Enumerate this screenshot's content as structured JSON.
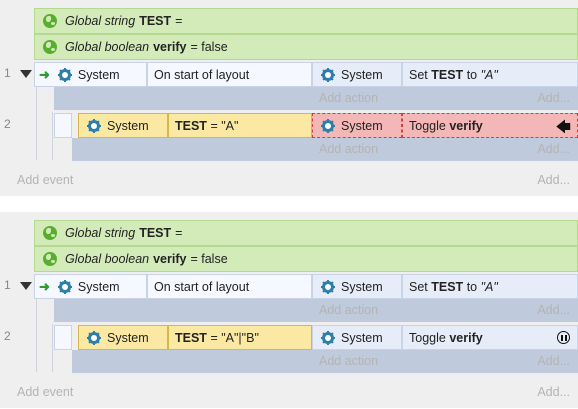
{
  "panels": [
    {
      "global_string": {
        "type": "Global string",
        "name": "TEST",
        "suffix": "="
      },
      "global_boolean": {
        "type": "Global boolean",
        "name": "verify",
        "suffix": "= false"
      },
      "event1": {
        "number": "1",
        "condition_object": "System",
        "condition_text": "On start of layout",
        "action_object": "System",
        "action_prefix": "Set",
        "action_var": "TEST",
        "action_mid": "to",
        "action_value": "\"A\"",
        "add_action": "Add action",
        "add_more": "Add..."
      },
      "event2": {
        "number": "2",
        "condition_object": "System",
        "condition_var": "TEST",
        "condition_value": "= \"A\"",
        "action_object": "System",
        "action_prefix": "Toggle",
        "action_var": "verify",
        "status_icon": "breakpoint-arrow-icon",
        "add_action": "Add action",
        "add_more": "Add..."
      },
      "add_event": "Add event",
      "add_more": "Add..."
    },
    {
      "global_string": {
        "type": "Global string",
        "name": "TEST",
        "suffix": "="
      },
      "global_boolean": {
        "type": "Global boolean",
        "name": "verify",
        "suffix": "= false"
      },
      "event1": {
        "number": "1",
        "condition_object": "System",
        "condition_text": "On start of layout",
        "action_object": "System",
        "action_prefix": "Set",
        "action_var": "TEST",
        "action_mid": "to",
        "action_value": "\"A\"",
        "add_action": "Add action",
        "add_more": "Add..."
      },
      "event2": {
        "number": "2",
        "condition_object": "System",
        "condition_var": "TEST",
        "condition_value": "= \"A\"|\"B\"",
        "action_object": "System",
        "action_prefix": "Toggle",
        "action_var": "verify",
        "status_icon": "pause-icon",
        "add_action": "Add action",
        "add_more": "Add..."
      },
      "add_event": "Add event",
      "add_more": "Add..."
    }
  ],
  "colors": {
    "global_bg": "#d3ebb8",
    "condition_highlight": "#fbe9a3",
    "action_error": "#f4b7b7",
    "system_icon": "#2d7faa"
  }
}
